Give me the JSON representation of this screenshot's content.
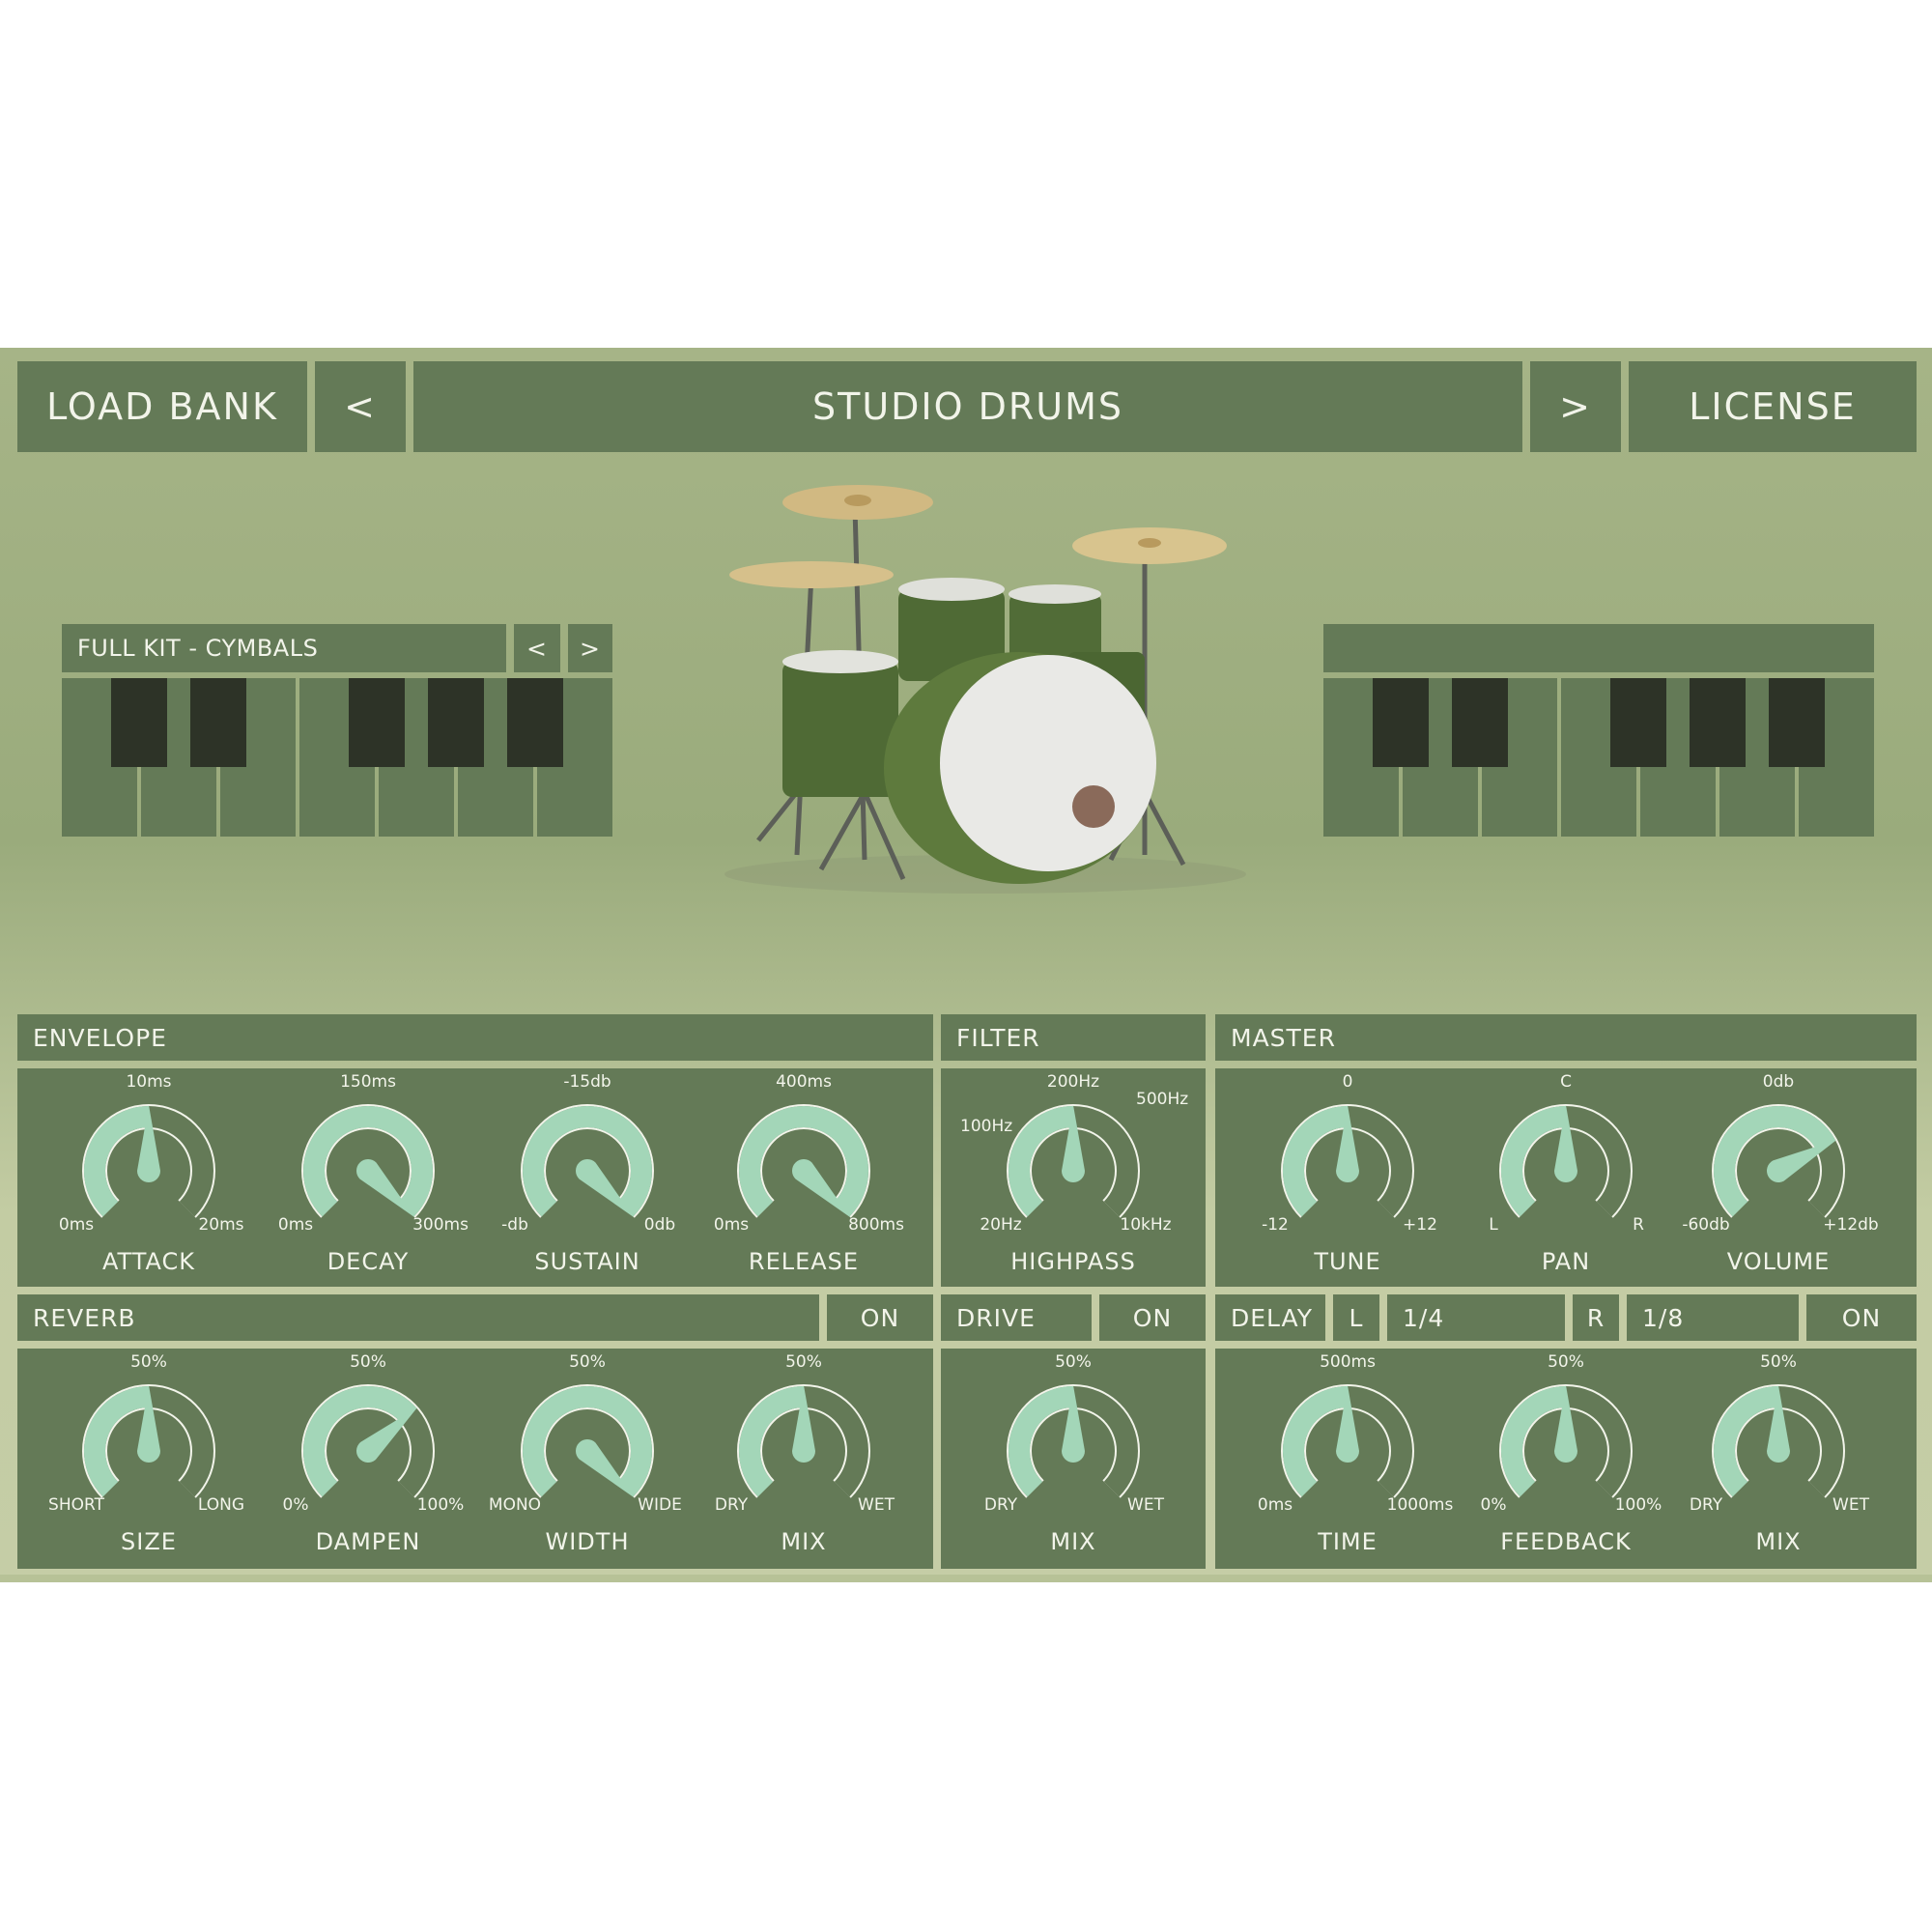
{
  "app": {
    "load_bank": "LOAD BANK",
    "prev": "<",
    "next": ">",
    "preset_name": "STUDIO DRUMS",
    "license": "LICENSE"
  },
  "colors": {
    "panel": "#647a57",
    "knob_arc": "#a3d6b8",
    "dark_key": "#2d3327",
    "text": "#f2f4ea"
  },
  "kit": {
    "left_label": "FULL KIT - CYMBALS",
    "left_prev": "<",
    "left_next": ">",
    "right_label": ""
  },
  "sections": {
    "envelope": "ENVELOPE",
    "filter": "FILTER",
    "master": "MASTER",
    "reverb": "REVERB",
    "reverb_toggle": "ON",
    "drive": "DRIVE",
    "drive_toggle": "ON",
    "delay": "DELAY",
    "delay_l": "L",
    "delay_l_value": "1/4",
    "delay_r": "R",
    "delay_r_value": "1/8",
    "delay_toggle": "ON"
  },
  "knobs": {
    "attack": {
      "name": "ATTACK",
      "value": "10ms",
      "min": "0ms",
      "max": "20ms",
      "level": 0.5
    },
    "decay": {
      "name": "DECAY",
      "value": "150ms",
      "min": "0ms",
      "max": "300ms",
      "level": 1.0
    },
    "sustain": {
      "name": "SUSTAIN",
      "value": "-15db",
      "min": "-db",
      "max": "0db",
      "level": 1.0
    },
    "release": {
      "name": "RELEASE",
      "value": "400ms",
      "min": "0ms",
      "max": "800ms",
      "level": 1.0
    },
    "highpass": {
      "name": "HIGHPASS",
      "value": "200Hz",
      "min": "20Hz",
      "max": "10kHz",
      "level": 0.5,
      "mark_left": "100Hz",
      "mark_right": "500Hz"
    },
    "tune": {
      "name": "TUNE",
      "value": "0",
      "min": "-12",
      "max": "+12",
      "level": 0.5
    },
    "pan": {
      "name": "PAN",
      "value": "C",
      "min": "L",
      "max": "R",
      "level": 0.5
    },
    "volume": {
      "name": "VOLUME",
      "value": "0db",
      "min": "-60db",
      "max": "+12db",
      "level": 0.73
    },
    "size": {
      "name": "SIZE",
      "value": "50%",
      "min": "SHORT",
      "max": "LONG",
      "level": 0.5
    },
    "dampen": {
      "name": "DAMPEN",
      "value": "50%",
      "min": "0%",
      "max": "100%",
      "level": 0.68
    },
    "width": {
      "name": "WIDTH",
      "value": "50%",
      "min": "MONO",
      "max": "WIDE",
      "level": 1.0
    },
    "rev_mix": {
      "name": "MIX",
      "value": "50%",
      "min": "DRY",
      "max": "WET",
      "level": 0.5
    },
    "drive_mix": {
      "name": "MIX",
      "value": "50%",
      "min": "DRY",
      "max": "WET",
      "level": 0.5
    },
    "time": {
      "name": "TIME",
      "value": "500ms",
      "min": "0ms",
      "max": "1000ms",
      "level": 0.5
    },
    "feedback": {
      "name": "FEEDBACK",
      "value": "50%",
      "min": "0%",
      "max": "100%",
      "level": 0.5
    },
    "delay_mix": {
      "name": "MIX",
      "value": "50%",
      "min": "DRY",
      "max": "WET",
      "level": 0.5
    }
  }
}
